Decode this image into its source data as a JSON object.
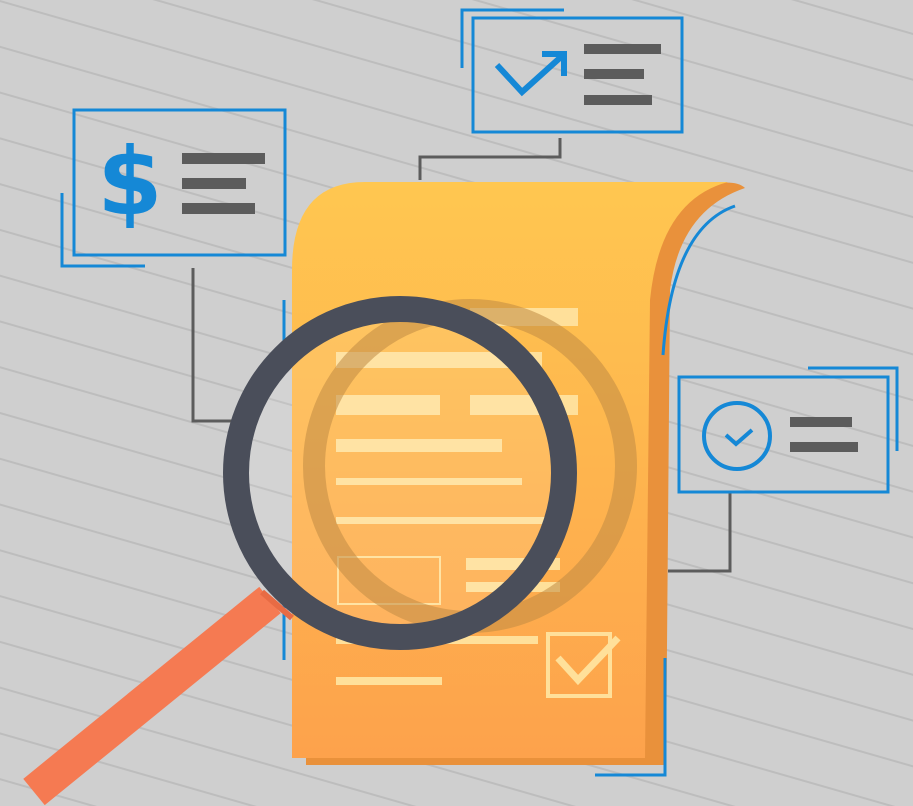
{
  "illustration": {
    "subject": "document-audit",
    "dollar_symbol": "$",
    "colors": {
      "background": "#cfcfcf",
      "stripe": "#bdbdbd",
      "accent_blue": "#1588d6",
      "connector_gray": "#5c5c5c",
      "document_orange": "#fbb04a",
      "document_fold": "#e9913b",
      "document_lines": "#ffe09a",
      "magnifier_ring": "#4a4e5a",
      "magnifier_handle": "#f57a52"
    },
    "icons": [
      "dollar-icon",
      "trend-up-check-icon",
      "clock-icon",
      "checkbox-check-icon",
      "magnifying-glass-icon",
      "document-icon"
    ]
  }
}
